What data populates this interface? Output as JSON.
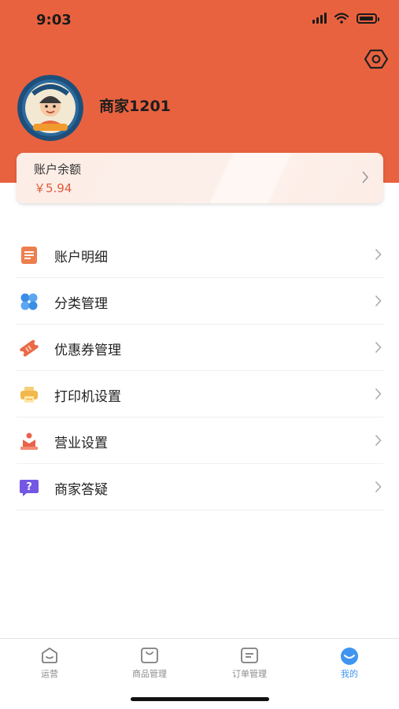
{
  "status_bar": {
    "time": "9:03"
  },
  "profile": {
    "name": "商家1201",
    "avatar_icon": "merchant-logo-avatar"
  },
  "balance": {
    "label": "账户余额",
    "value": "￥5.94"
  },
  "menu": [
    {
      "label": "账户明细",
      "icon": "document-list-icon",
      "color": "#EE7E4D"
    },
    {
      "label": "分类管理",
      "icon": "four-petal-category-icon",
      "color": "#3A8EE6"
    },
    {
      "label": "优惠券管理",
      "icon": "coupon-icon",
      "color": "#EA6A47"
    },
    {
      "label": "打印机设置",
      "icon": "printer-icon",
      "color": "#F2B84B"
    },
    {
      "label": "营业设置",
      "icon": "storefront-icon",
      "color": "#E9614A"
    },
    {
      "label": "商家答疑",
      "icon": "question-chat-icon",
      "color": "#7457E4"
    }
  ],
  "tabs": [
    {
      "label": "运营",
      "icon": "operations-icon"
    },
    {
      "label": "商品管理",
      "icon": "shopping-bag-icon"
    },
    {
      "label": "订单管理",
      "icon": "order-icon"
    },
    {
      "label": "我的",
      "icon": "profile-smile-icon"
    }
  ],
  "colors": {
    "header": "#E9623F",
    "accent": "#3F95EF",
    "balance_value": "#E05A3C"
  }
}
